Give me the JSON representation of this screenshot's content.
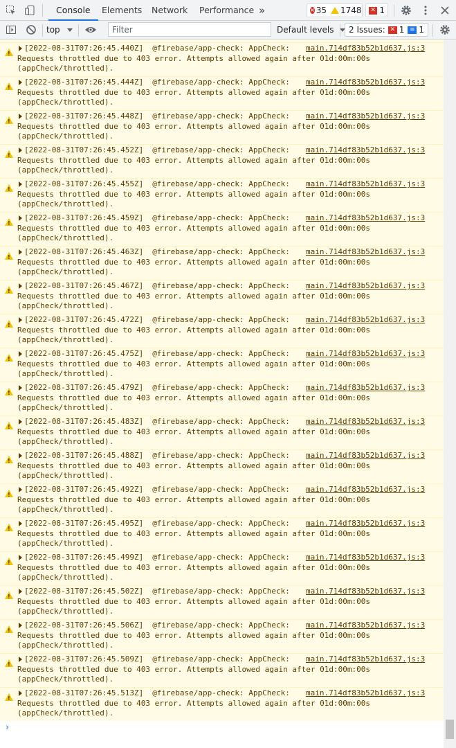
{
  "tabs": [
    {
      "label": "Console",
      "active": true
    },
    {
      "label": "Elements",
      "active": false
    },
    {
      "label": "Network",
      "active": false
    },
    {
      "label": "Performance",
      "active": false
    }
  ],
  "more_tabs_icon": "»",
  "counters": {
    "errors": "35",
    "warnings": "1748",
    "issues": "1"
  },
  "toolbar": {
    "context": "top",
    "filter_placeholder": "Filter",
    "levels": "Default levels",
    "issues_label": "2 Issues:",
    "issues_errors": "1",
    "issues_info": "1"
  },
  "colors": {
    "warning_bg": "#fffbe5",
    "warning_text": "#5c3c00",
    "accent": "#1a73e8",
    "error": "#d93025"
  },
  "messages": [
    {
      "time": "[2022-08-31T07:26:45.440Z]",
      "tag": "@firebase/app-check: AppCheck:",
      "line2": "Requests throttled due to 403 error. Attempts allowed again after 01d:00m:00s",
      "line3": "(appCheck/throttled).",
      "source": "main.714df83b52b1d637.js:3"
    },
    {
      "time": "[2022-08-31T07:26:45.444Z]",
      "tag": "@firebase/app-check: AppCheck:",
      "line2": "Requests throttled due to 403 error. Attempts allowed again after 01d:00m:00s",
      "line3": "(appCheck/throttled).",
      "source": "main.714df83b52b1d637.js:3"
    },
    {
      "time": "[2022-08-31T07:26:45.448Z]",
      "tag": "@firebase/app-check: AppCheck:",
      "line2": "Requests throttled due to 403 error. Attempts allowed again after 01d:00m:00s",
      "line3": "(appCheck/throttled).",
      "source": "main.714df83b52b1d637.js:3"
    },
    {
      "time": "[2022-08-31T07:26:45.452Z]",
      "tag": "@firebase/app-check: AppCheck:",
      "line2": "Requests throttled due to 403 error. Attempts allowed again after 01d:00m:00s",
      "line3": "(appCheck/throttled).",
      "source": "main.714df83b52b1d637.js:3"
    },
    {
      "time": "[2022-08-31T07:26:45.455Z]",
      "tag": "@firebase/app-check: AppCheck:",
      "line2": "Requests throttled due to 403 error. Attempts allowed again after 01d:00m:00s",
      "line3": "(appCheck/throttled).",
      "source": "main.714df83b52b1d637.js:3"
    },
    {
      "time": "[2022-08-31T07:26:45.459Z]",
      "tag": "@firebase/app-check: AppCheck:",
      "line2": "Requests throttled due to 403 error. Attempts allowed again after 01d:00m:00s",
      "line3": "(appCheck/throttled).",
      "source": "main.714df83b52b1d637.js:3"
    },
    {
      "time": "[2022-08-31T07:26:45.463Z]",
      "tag": "@firebase/app-check: AppCheck:",
      "line2": "Requests throttled due to 403 error. Attempts allowed again after 01d:00m:00s",
      "line3": "(appCheck/throttled).",
      "source": "main.714df83b52b1d637.js:3"
    },
    {
      "time": "[2022-08-31T07:26:45.467Z]",
      "tag": "@firebase/app-check: AppCheck:",
      "line2": "Requests throttled due to 403 error. Attempts allowed again after 01d:00m:00s",
      "line3": "(appCheck/throttled).",
      "source": "main.714df83b52b1d637.js:3"
    },
    {
      "time": "[2022-08-31T07:26:45.472Z]",
      "tag": "@firebase/app-check: AppCheck:",
      "line2": "Requests throttled due to 403 error. Attempts allowed again after 01d:00m:00s",
      "line3": "(appCheck/throttled).",
      "source": "main.714df83b52b1d637.js:3"
    },
    {
      "time": "[2022-08-31T07:26:45.475Z]",
      "tag": "@firebase/app-check: AppCheck:",
      "line2": "Requests throttled due to 403 error. Attempts allowed again after 01d:00m:00s",
      "line3": "(appCheck/throttled).",
      "source": "main.714df83b52b1d637.js:3"
    },
    {
      "time": "[2022-08-31T07:26:45.479Z]",
      "tag": "@firebase/app-check: AppCheck:",
      "line2": "Requests throttled due to 403 error. Attempts allowed again after 01d:00m:00s",
      "line3": "(appCheck/throttled).",
      "source": "main.714df83b52b1d637.js:3"
    },
    {
      "time": "[2022-08-31T07:26:45.483Z]",
      "tag": "@firebase/app-check: AppCheck:",
      "line2": "Requests throttled due to 403 error. Attempts allowed again after 01d:00m:00s",
      "line3": "(appCheck/throttled).",
      "source": "main.714df83b52b1d637.js:3"
    },
    {
      "time": "[2022-08-31T07:26:45.488Z]",
      "tag": "@firebase/app-check: AppCheck:",
      "line2": "Requests throttled due to 403 error. Attempts allowed again after 01d:00m:00s",
      "line3": "(appCheck/throttled).",
      "source": "main.714df83b52b1d637.js:3"
    },
    {
      "time": "[2022-08-31T07:26:45.492Z]",
      "tag": "@firebase/app-check: AppCheck:",
      "line2": "Requests throttled due to 403 error. Attempts allowed again after 01d:00m:00s",
      "line3": "(appCheck/throttled).",
      "source": "main.714df83b52b1d637.js:3"
    },
    {
      "time": "[2022-08-31T07:26:45.495Z]",
      "tag": "@firebase/app-check: AppCheck:",
      "line2": "Requests throttled due to 403 error. Attempts allowed again after 01d:00m:00s",
      "line3": "(appCheck/throttled).",
      "source": "main.714df83b52b1d637.js:3"
    },
    {
      "time": "[2022-08-31T07:26:45.499Z]",
      "tag": "@firebase/app-check: AppCheck:",
      "line2": "Requests throttled due to 403 error. Attempts allowed again after 01d:00m:00s",
      "line3": "(appCheck/throttled).",
      "source": "main.714df83b52b1d637.js:3"
    },
    {
      "time": "[2022-08-31T07:26:45.502Z]",
      "tag": "@firebase/app-check: AppCheck:",
      "line2": "Requests throttled due to 403 error. Attempts allowed again after 01d:00m:00s",
      "line3": "(appCheck/throttled).",
      "source": "main.714df83b52b1d637.js:3"
    },
    {
      "time": "[2022-08-31T07:26:45.506Z]",
      "tag": "@firebase/app-check: AppCheck:",
      "line2": "Requests throttled due to 403 error. Attempts allowed again after 01d:00m:00s",
      "line3": "(appCheck/throttled).",
      "source": "main.714df83b52b1d637.js:3"
    },
    {
      "time": "[2022-08-31T07:26:45.509Z]",
      "tag": "@firebase/app-check: AppCheck:",
      "line2": "Requests throttled due to 403 error. Attempts allowed again after 01d:00m:00s",
      "line3": "(appCheck/throttled).",
      "source": "main.714df83b52b1d637.js:3"
    },
    {
      "time": "[2022-08-31T07:26:45.513Z]",
      "tag": "@firebase/app-check: AppCheck:",
      "line2": "Requests throttled due to 403 error. Attempts allowed again after 01d:00m:00s",
      "line3": "(appCheck/throttled).",
      "source": "main.714df83b52b1d637.js:3"
    }
  ],
  "prompt_symbol": "›"
}
